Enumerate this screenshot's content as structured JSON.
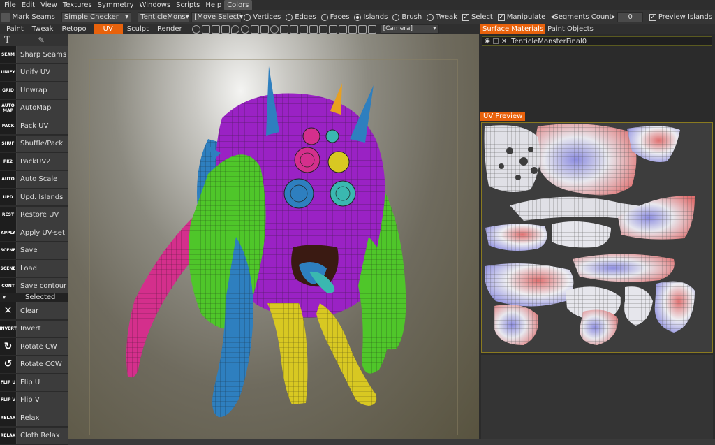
{
  "menubar": {
    "items": [
      "File",
      "Edit",
      "View",
      "Textures",
      "Symmetry",
      "Windows",
      "Scripts",
      "Help",
      "Colors"
    ]
  },
  "toolbar": {
    "tool_label": "Mark Seams",
    "checker_combo": "Simple Checker",
    "object_combo": "TenticleMons",
    "mode_combo": "[Move Select",
    "vertices": "Vertices",
    "edges": "Edges",
    "faces": "Faces",
    "islands": "Islands",
    "brush": "Brush",
    "tweak": "Tweak",
    "select": "Select",
    "manipulate": "Manipulate",
    "segments_label": "◂Segments Count▸",
    "segments_value": "0",
    "preview_islands": "Preview Islands"
  },
  "rooms": [
    "Paint",
    "Tweak",
    "Retopo",
    "UV",
    "Sculpt",
    "Render"
  ],
  "camera": "[Camera]",
  "left_tools": [
    {
      "icon": "SEAM",
      "label": "Sharp Seams"
    },
    {
      "icon": "UNIFY",
      "label": "Unify UV"
    },
    {
      "icon": "GRID",
      "label": "Unwrap"
    },
    {
      "icon": "AUTO MAP",
      "label": "AutoMap"
    },
    {
      "icon": "PACK",
      "label": "Pack UV"
    },
    {
      "icon": "SHUF",
      "label": "Shuffle/Pack"
    },
    {
      "icon": "PK2",
      "label": "PackUV2"
    },
    {
      "icon": "AUTO",
      "label": "Auto Scale"
    },
    {
      "icon": "UPD",
      "label": "Upd. Islands"
    },
    {
      "icon": "REST",
      "label": "Restore UV"
    },
    {
      "icon": "APPLY",
      "label": "Apply UV-set"
    },
    {
      "icon": "SCENE",
      "label": "Save"
    },
    {
      "icon": "SCENE",
      "label": "Load"
    },
    {
      "icon": "CONT",
      "label": "Save contour"
    }
  ],
  "selected_header": "Selected",
  "selected_tools": [
    {
      "icon": "✕",
      "label": "Clear"
    },
    {
      "icon": "INVERT",
      "label": "Invert"
    },
    {
      "icon": "↻",
      "label": "Rotate CW"
    },
    {
      "icon": "↺",
      "label": "Rotate CCW"
    },
    {
      "icon": "FLIP U",
      "label": "Flip U"
    },
    {
      "icon": "FLIP V",
      "label": "Flip V"
    },
    {
      "icon": "RELAX",
      "label": "Relax"
    },
    {
      "icon": "RELAX",
      "label": "Cloth Relax"
    }
  ],
  "right_tabs": [
    "Surface Materials",
    "Paint Objects"
  ],
  "material_name": "TenticleMonsterFinal0",
  "uv_preview_label": "UV Preview",
  "colors": {
    "accent": "#e8620c",
    "purple": "#9a22c4",
    "green": "#4fc62a",
    "blue": "#2e7fbf",
    "yellow": "#d8c822",
    "pink": "#d42f8c",
    "teal": "#3ab8b0"
  }
}
